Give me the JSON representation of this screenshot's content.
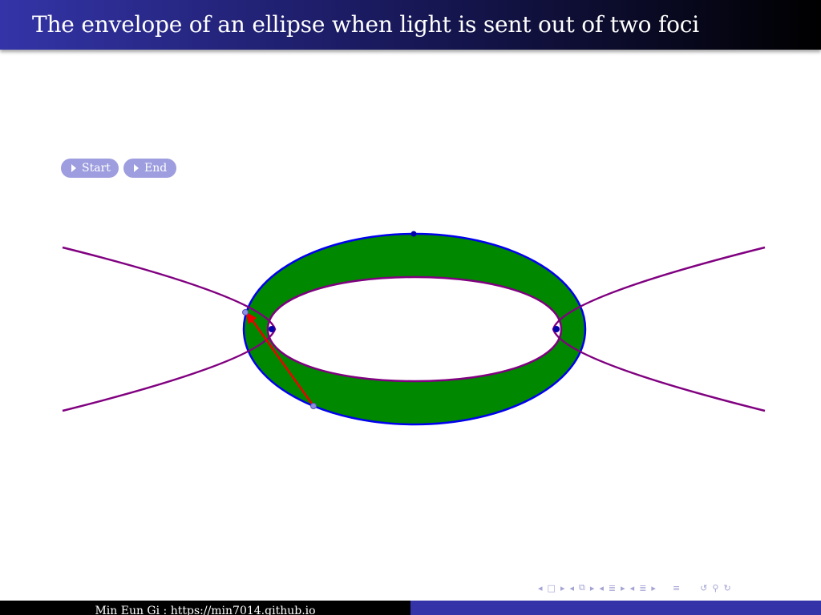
{
  "slide": {
    "title": "The envelope of an ellipse when light is sent out of two foci"
  },
  "controls": {
    "start_label": "Start",
    "end_label": "End"
  },
  "nav_icons": [
    "arrow-left-icon",
    "frame-icon",
    "arrow-right-icon",
    "arrow-left-icon",
    "subsection-icon",
    "arrow-right-icon",
    "arrow-left-icon",
    "section-icon",
    "arrow-right-icon",
    "arrow-left-icon",
    "section-list-icon",
    "arrow-right-icon",
    "align-icon",
    "search-back-icon",
    "search-icon",
    "search-forward-icon"
  ],
  "footer": {
    "author_url": "Min Eun Gi : https://min7014.github.io"
  },
  "colors": {
    "title_gradient_start": "#3434a8",
    "title_gradient_end": "#000000",
    "ellipse_fill": "#008800",
    "ellipse_stroke": "#0000ee",
    "envelope_stroke": "#800080",
    "ray": "#ee0000",
    "point": "#0000aa",
    "button_bg": "#9d9ddf"
  }
}
